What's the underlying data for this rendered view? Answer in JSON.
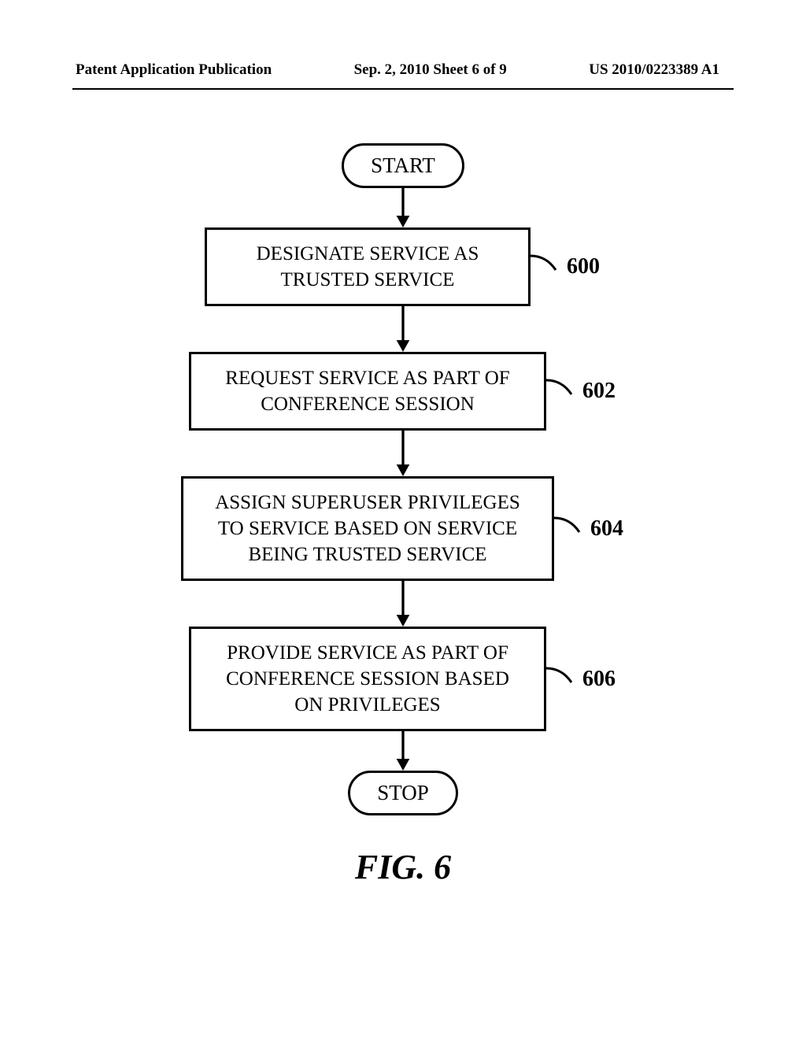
{
  "header": {
    "left": "Patent Application Publication",
    "center": "Sep. 2, 2010  Sheet 6 of 9",
    "right": "US 2010/0223389 A1"
  },
  "flow": {
    "start": "START",
    "stop": "STOP",
    "steps": [
      {
        "ref": "600",
        "text": "DESIGNATE SERVICE AS\nTRUSTED SERVICE"
      },
      {
        "ref": "602",
        "text": "REQUEST SERVICE AS PART OF\nCONFERENCE SESSION"
      },
      {
        "ref": "604",
        "text": "ASSIGN SUPERUSER PRIVILEGES\nTO SERVICE BASED ON SERVICE\nBEING TRUSTED SERVICE"
      },
      {
        "ref": "606",
        "text": "PROVIDE SERVICE AS PART OF\nCONFERENCE SESSION BASED\nON PRIVILEGES"
      }
    ]
  },
  "figure_label": "FIG. 6"
}
